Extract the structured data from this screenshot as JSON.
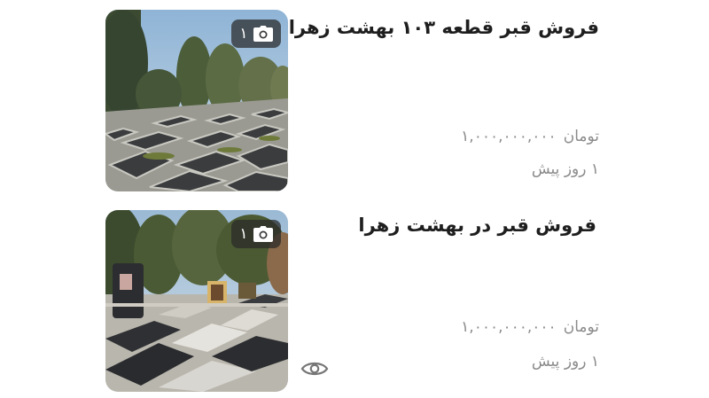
{
  "listings": [
    {
      "title": "فروش قبر قطعه ۱۰۳ بهشت زهرا",
      "price_value": "۱,۰۰۰,۰۰۰,۰۰۰",
      "price_unit": "تومان",
      "time_ago": "۱ روز پیش",
      "photo_count": "۱",
      "image_icon": "camera-icon"
    },
    {
      "title": "فروش قبر در بهشت زهرا",
      "price_value": "۱,۰۰۰,۰۰۰,۰۰۰",
      "price_unit": "تومان",
      "time_ago": "۱ روز پیش",
      "photo_count": "۱",
      "image_icon": "camera-icon",
      "action_icon": "eye-icon"
    }
  ],
  "colors": {
    "title": "#1e1e1e",
    "meta_text": "#8b8b8b",
    "badge_bg": "#282828"
  }
}
